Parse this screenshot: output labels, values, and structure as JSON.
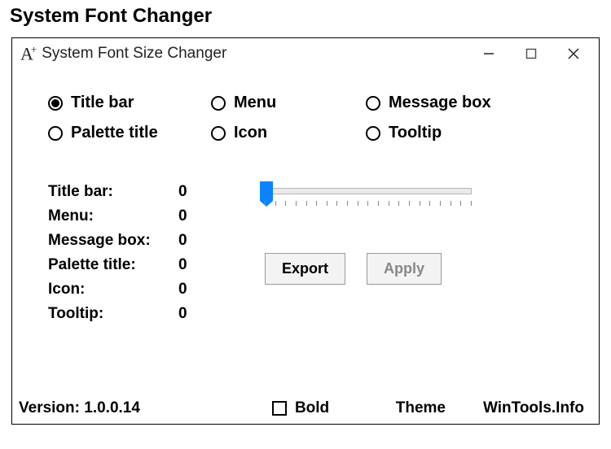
{
  "outer_title": "System Font Changer",
  "window": {
    "title": "System Font Size Changer",
    "icon_name": "a-plus-icon"
  },
  "radios": {
    "options": [
      {
        "id": "titlebar",
        "label": "Title bar",
        "checked": true
      },
      {
        "id": "menu",
        "label": "Menu",
        "checked": false
      },
      {
        "id": "messagebox",
        "label": "Message box",
        "checked": false
      },
      {
        "id": "palettetitle",
        "label": "Palette title",
        "checked": false
      },
      {
        "id": "icon",
        "label": "Icon",
        "checked": false
      },
      {
        "id": "tooltip",
        "label": "Tooltip",
        "checked": false
      }
    ]
  },
  "values": {
    "rows": [
      {
        "label": "Title bar:",
        "value": "0"
      },
      {
        "label": "Menu:",
        "value": "0"
      },
      {
        "label": "Message box:",
        "value": "0"
      },
      {
        "label": "Palette title:",
        "value": "0"
      },
      {
        "label": "Icon:",
        "value": "0"
      },
      {
        "label": "Tooltip:",
        "value": "0"
      }
    ]
  },
  "slider": {
    "min": 0,
    "max": 20,
    "value": 0
  },
  "buttons": {
    "export": "Export",
    "apply": "Apply"
  },
  "footer": {
    "version_label": "Version:",
    "version_value": "1.0.0.14",
    "bold_label": "Bold",
    "bold_checked": false,
    "theme_label": "Theme",
    "link_label": "WinTools.Info"
  }
}
